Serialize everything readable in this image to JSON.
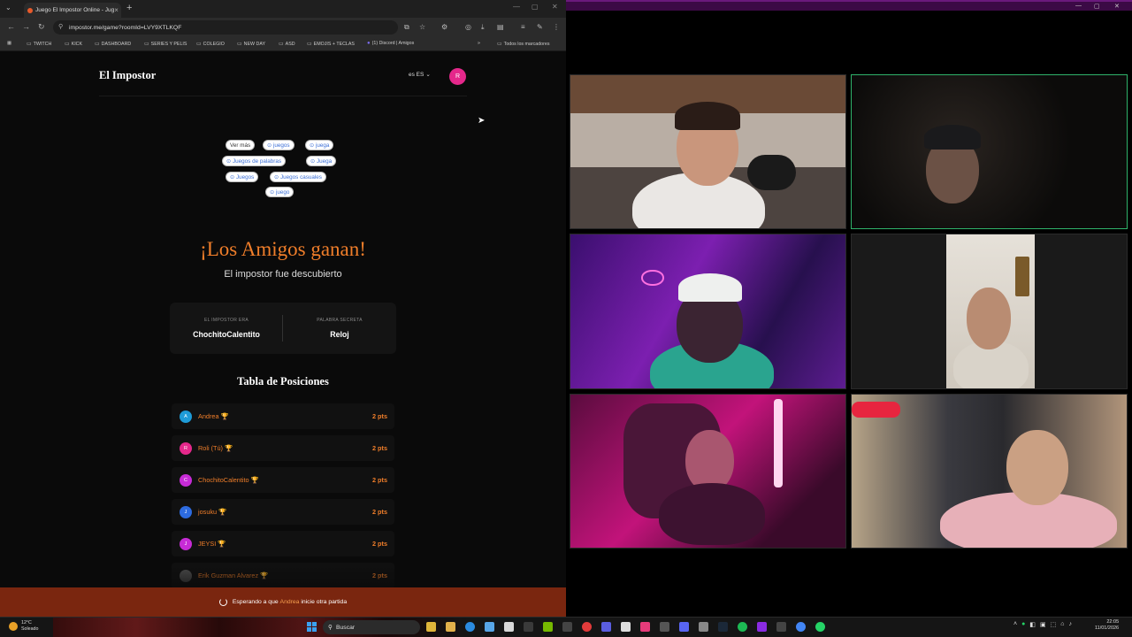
{
  "browser": {
    "tab_title": "Juego El Impostor Online - Jug",
    "url": "impostor.me/game?roomId=LVY9XTLKQF",
    "bookmarks": [
      "TWITCH",
      "KICK",
      "DASHBOARD",
      "SERIES Y PELIS",
      "COLEGIO",
      "NEW DAY",
      "ASD",
      "EMOJIS + TECLAS",
      "(1) Discord | Amigos"
    ],
    "bookmarks_more": "»",
    "all_bookmarks": "Todos los marcadores"
  },
  "app": {
    "logo": "El Impostor",
    "lang": "es ES",
    "avatar_initial": "R",
    "chips": {
      "ver_mas": "Ver más",
      "c1": "⊙ juegos",
      "c2": "⊙ juega",
      "c3": "⊙ Juegos de palabras",
      "c4": "⊙ Juega",
      "c5": "⊙ Juegos",
      "c6": "⊙ Juegos casuales",
      "c7": "⊙ juego"
    },
    "result_title": "¡Los Amigos ganan!",
    "result_subtitle": "El impostor fue descubierto",
    "impostor_label": "EL IMPOSTOR ERA",
    "impostor_name": "ChochitoCalentito",
    "secret_label": "PALABRA SECRETA",
    "secret_word": "Reloj",
    "leaderboard_title": "Tabla de Posiciones",
    "players": [
      {
        "initial": "A",
        "name": "Andrea",
        "points": "2 pts",
        "color": "#1e9bd7"
      },
      {
        "initial": "R",
        "name": "Roli (Tú)",
        "points": "2 pts",
        "color": "#e5288b"
      },
      {
        "initial": "C",
        "name": "ChochitoCalentito",
        "points": "2 pts",
        "color": "#c72bd6"
      },
      {
        "initial": "J",
        "name": "josuku",
        "points": "2 pts",
        "color": "#2d6be0"
      },
      {
        "initial": "J",
        "name": "JEYSI",
        "points": "2 pts",
        "color": "#c72bd6"
      },
      {
        "initial": "",
        "name": "Erik Guzman Alvarez",
        "points": "2 pts",
        "color": "#555555"
      }
    ],
    "trophy": "🏆",
    "waiting_prefix": "Esperando a que",
    "waiting_name": "Andrea",
    "waiting_suffix": "inicie otra partida"
  },
  "taskbar": {
    "temperature": "12°C",
    "weather": "Soleado",
    "search_placeholder": "Buscar",
    "time": "22:05",
    "date": "11/01/2026"
  }
}
